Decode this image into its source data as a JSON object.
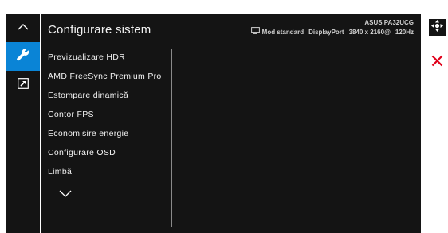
{
  "left_menu": {
    "items": [
      {
        "icon": "chevron-up-icon"
      },
      {
        "icon": "wrench-icon",
        "active": true
      },
      {
        "icon": "shortcut-arrow-icon"
      }
    ]
  },
  "header": {
    "title": "Configurare sistem",
    "model": "ASUS PA32UCG",
    "mode": "Mod standard",
    "input": "DisplayPort",
    "resolution": "3840 x 2160@",
    "refresh": "120Hz"
  },
  "menu": {
    "items": [
      "Previzualizare HDR",
      "AMD FreeSync Premium Pro",
      "Estompare dinamică",
      "Contor FPS",
      "Economisire energie",
      "Configurare OSD",
      "Limbă"
    ],
    "more_icon": "chevron-down-icon"
  },
  "controls": {
    "navigate_icon": "dpad-icon",
    "close_icon": "close-icon",
    "close_color": "#e0001a",
    "accent_color": "#0a84d6"
  }
}
